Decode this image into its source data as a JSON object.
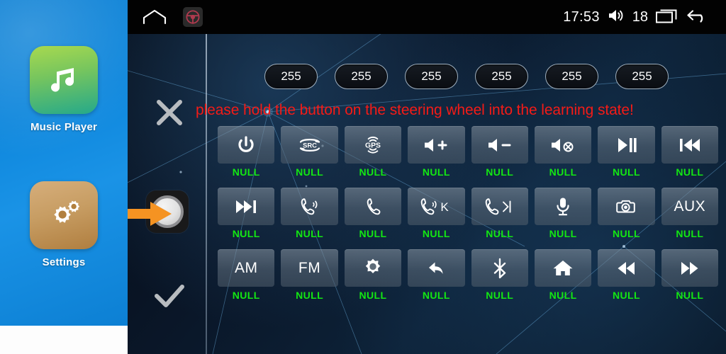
{
  "launcher": {
    "apps": [
      {
        "label": "Music Player",
        "icon": "music-note-icon"
      },
      {
        "label": "Settings",
        "icon": "gears-icon"
      }
    ]
  },
  "statusbar": {
    "home_icon": "home-outline-icon",
    "steering_wheel_icon": "steering-wheel-icon",
    "time": "17:53",
    "volume_icon": "volume-icon",
    "volume_level": "18",
    "recents_icon": "recent-apps-icon",
    "back_icon": "back-arrow-icon"
  },
  "sidebar": {
    "cancel_icon": "close-x-icon",
    "knob_icon": "rotary-knob-icon",
    "confirm_icon": "checkmark-icon",
    "pointer_icon": "orange-arrow-icon"
  },
  "values": {
    "pills": [
      "255",
      "255",
      "255",
      "255",
      "255",
      "255"
    ]
  },
  "message": {
    "warning": "please hold the button on the steering wheel into the learning state!",
    "warning_color": "#f41b17"
  },
  "grid": {
    "null_label": "NULL",
    "null_color": "#13e713",
    "keys": [
      {
        "icon": "power-icon",
        "text": "",
        "assigned": "NULL"
      },
      {
        "icon": "src-source-icon",
        "text": "SRC",
        "assigned": "NULL"
      },
      {
        "icon": "gps-icon",
        "text": "GPS",
        "assigned": "NULL"
      },
      {
        "icon": "volume-up-icon",
        "text": "",
        "assigned": "NULL"
      },
      {
        "icon": "volume-down-icon",
        "text": "",
        "assigned": "NULL"
      },
      {
        "icon": "volume-mute-icon",
        "text": "",
        "assigned": "NULL"
      },
      {
        "icon": "play-pause-icon",
        "text": "",
        "assigned": "NULL"
      },
      {
        "icon": "previous-track-icon",
        "text": "",
        "assigned": "NULL"
      },
      {
        "icon": "next-track-icon",
        "text": "",
        "assigned": "NULL"
      },
      {
        "icon": "phone-answer-icon",
        "text": "",
        "assigned": "NULL"
      },
      {
        "icon": "phone-hangup-icon",
        "text": "",
        "assigned": "NULL"
      },
      {
        "icon": "phone-answer-k-icon",
        "text": "",
        "assigned": "NULL"
      },
      {
        "icon": "phone-hangup-next-icon",
        "text": "",
        "assigned": "NULL"
      },
      {
        "icon": "microphone-icon",
        "text": "",
        "assigned": "NULL"
      },
      {
        "icon": "camera-icon",
        "text": "",
        "assigned": "NULL"
      },
      {
        "icon": "aux-icon",
        "text": "AUX",
        "assigned": "NULL"
      },
      {
        "icon": "am-radio-icon",
        "text": "AM",
        "assigned": "NULL"
      },
      {
        "icon": "fm-radio-icon",
        "text": "FM",
        "assigned": "NULL"
      },
      {
        "icon": "brightness-icon",
        "text": "",
        "assigned": "NULL"
      },
      {
        "icon": "return-back-icon",
        "text": "",
        "assigned": "NULL"
      },
      {
        "icon": "bluetooth-icon",
        "text": "",
        "assigned": "NULL"
      },
      {
        "icon": "home-icon",
        "text": "",
        "assigned": "NULL"
      },
      {
        "icon": "rewind-icon",
        "text": "",
        "assigned": "NULL"
      },
      {
        "icon": "fast-forward-icon",
        "text": "",
        "assigned": "NULL"
      }
    ]
  }
}
